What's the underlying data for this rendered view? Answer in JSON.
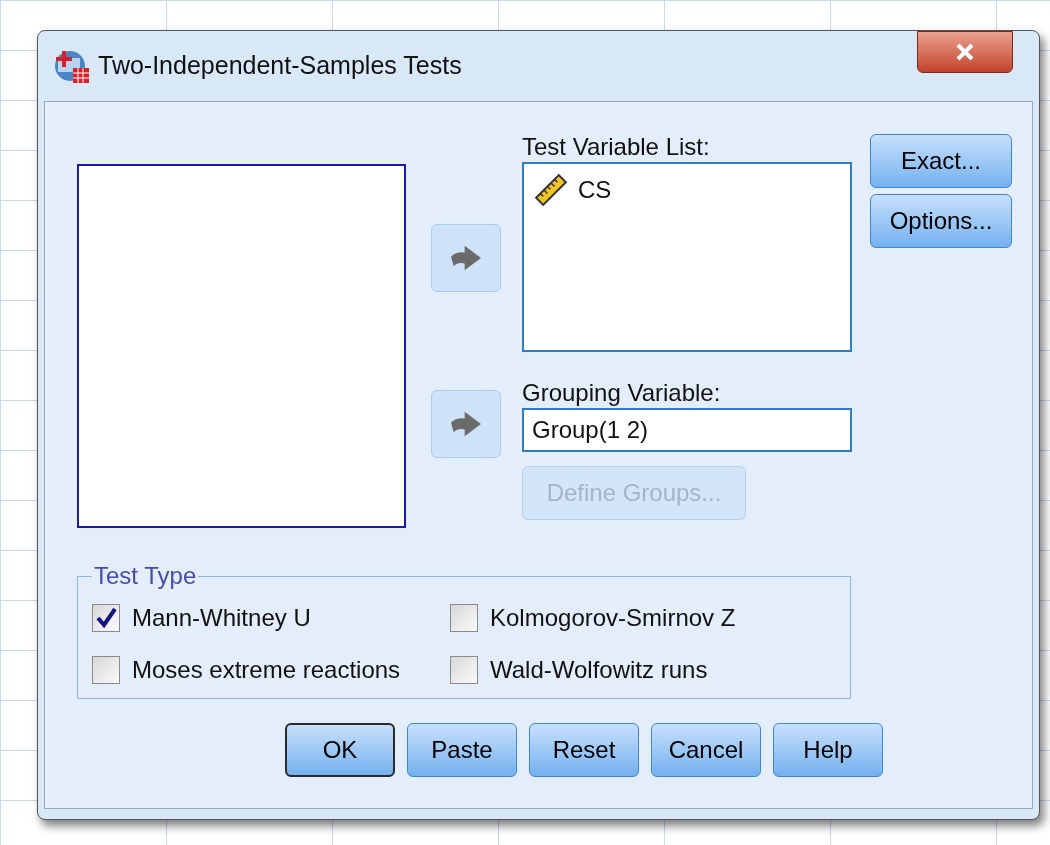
{
  "window": {
    "title": "Two-Independent-Samples Tests"
  },
  "test_variable_list": {
    "label": "Test Variable List:",
    "items": [
      {
        "name": "CS",
        "kind": "scale"
      }
    ]
  },
  "grouping_variable": {
    "label": "Grouping Variable:",
    "value": "Group(1 2)"
  },
  "define_groups_button": {
    "label": "Define Groups...",
    "disabled": true
  },
  "side_buttons": [
    {
      "label": "Exact..."
    },
    {
      "label": "Options..."
    }
  ],
  "test_type": {
    "title": "Test Type",
    "options": [
      {
        "label": "Mann-Whitney U",
        "checked": true
      },
      {
        "label": "Kolmogorov-Smirnov Z",
        "checked": false
      },
      {
        "label": "Moses extreme reactions",
        "checked": false
      },
      {
        "label": "Wald-Wolfowitz runs",
        "checked": false
      }
    ]
  },
  "buttons": [
    {
      "label": "OK",
      "default": true
    },
    {
      "label": "Paste",
      "default": false
    },
    {
      "label": "Reset",
      "default": false
    },
    {
      "label": "Cancel",
      "default": false
    },
    {
      "label": "Help",
      "default": false
    }
  ]
}
